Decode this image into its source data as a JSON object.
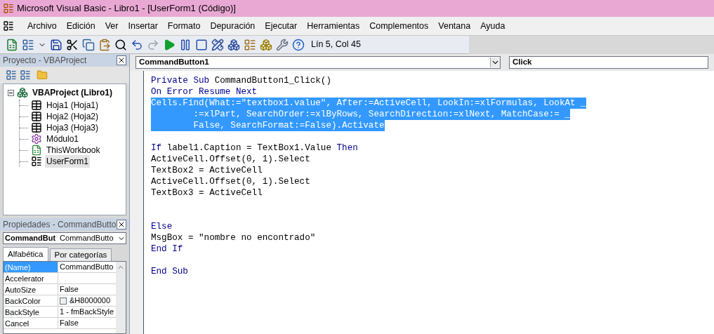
{
  "window": {
    "title": "Microsoft Visual Basic - Libro1 - [UserForm1 (Código)]"
  },
  "menu": [
    "Archivo",
    "Edición",
    "Ver",
    "Insertar",
    "Formato",
    "Depuración",
    "Ejecutar",
    "Herramientas",
    "Complementos",
    "Ventana",
    "Ayuda"
  ],
  "toolbar": {
    "position": "Lín 5, Col 45"
  },
  "project": {
    "title": "Proyecto - VBAProject",
    "tree": [
      {
        "label": "VBAProject (Libro1)",
        "kind": "project",
        "expanded": true,
        "selected": false,
        "children": [
          {
            "label": "Hoja1 (Hoja1)",
            "kind": "sheet",
            "selected": false
          },
          {
            "label": "Hoja2 (Hoja2)",
            "kind": "sheet",
            "selected": false
          },
          {
            "label": "Hoja3 (Hoja3)",
            "kind": "sheet",
            "selected": false
          },
          {
            "label": "Módulo1",
            "kind": "module",
            "selected": false
          },
          {
            "label": "ThisWorkbook",
            "kind": "workbook",
            "selected": false
          },
          {
            "label": "UserForm1",
            "kind": "form",
            "selected": true
          }
        ]
      }
    ]
  },
  "properties": {
    "title": "Propiedades - CommandButto",
    "object_name": "CommandBut",
    "object_type": "CommandButto",
    "tabs": [
      {
        "label": "Alfabética",
        "selected": true
      },
      {
        "label": "Por categorías",
        "selected": false
      }
    ],
    "rows": [
      {
        "name": "(Name)",
        "value": "CommandButto",
        "kind": "text",
        "selected": true
      },
      {
        "name": "Accelerator",
        "kind": "text",
        "selected": false
      },
      {
        "name": "AutoSize",
        "value": "False",
        "kind": "text",
        "selected": false
      },
      {
        "name": "BackColor",
        "value": "&H8000000",
        "kind": "color",
        "selected": false
      },
      {
        "name": "BackStyle",
        "value": "1 - fmBackStyle",
        "kind": "text",
        "selected": false
      },
      {
        "name": "Cancel",
        "value": "False",
        "kind": "text",
        "selected": false
      }
    ]
  },
  "code": {
    "object": "CommandButton1",
    "procedure": "Click",
    "lines": [
      {
        "kind": "code",
        "selected": false,
        "tokens": [
          {
            "text": "Private Sub",
            "kind": "keyword"
          },
          {
            "text": " CommandButton1_Click()",
            "kind": "plain"
          }
        ]
      },
      {
        "kind": "code",
        "selected": false,
        "tokens": [
          {
            "text": "On Error Resume Next",
            "kind": "keyword"
          }
        ]
      },
      {
        "kind": "code",
        "selected": true,
        "tokens": [
          {
            "text": "Cells.Find(What:=\"textbox1.value\", After:=ActiveCell, LookIn:=xlFormulas, LookAt _"
          }
        ]
      },
      {
        "kind": "code",
        "selected": true,
        "tokens": [
          {
            "text": "        :=xlPart, SearchOrder:=xlByRows, SearchDirection:=xlNext, MatchCase:= _"
          }
        ]
      },
      {
        "kind": "code",
        "selected": true,
        "tokens": [
          {
            "text": "        False, SearchFormat:=False).Activate"
          }
        ]
      },
      {
        "kind": "blank"
      },
      {
        "kind": "code",
        "selected": false,
        "tokens": [
          {
            "text": "If",
            "kind": "keyword"
          },
          {
            "text": " label1.Caption = TextBox1.Value ",
            "kind": "plain"
          },
          {
            "text": "Then",
            "kind": "keyword"
          }
        ]
      },
      {
        "kind": "code",
        "selected": false,
        "tokens": [
          {
            "text": "ActiveCell.Offset(0, 1).Select",
            "kind": "plain"
          }
        ]
      },
      {
        "kind": "code",
        "selected": false,
        "tokens": [
          {
            "text": "TextBox2 = ActiveCell",
            "kind": "plain"
          }
        ]
      },
      {
        "kind": "code",
        "selected": false,
        "tokens": [
          {
            "text": "ActiveCell.Offset(0, 1).Select",
            "kind": "plain"
          }
        ]
      },
      {
        "kind": "code",
        "selected": false,
        "tokens": [
          {
            "text": "TextBox3 = ActiveCell",
            "kind": "plain"
          }
        ]
      },
      {
        "kind": "blank"
      },
      {
        "kind": "blank"
      },
      {
        "kind": "code",
        "selected": false,
        "tokens": [
          {
            "text": "Else",
            "kind": "keyword"
          }
        ]
      },
      {
        "kind": "code",
        "selected": false,
        "tokens": [
          {
            "text": "MsgBox = \"nombre no encontrado\"",
            "kind": "plain"
          }
        ]
      },
      {
        "kind": "code",
        "selected": false,
        "tokens": [
          {
            "text": "End If",
            "kind": "keyword"
          }
        ]
      },
      {
        "kind": "blank"
      },
      {
        "kind": "code",
        "selected": false,
        "tokens": [
          {
            "text": "End Sub",
            "kind": "keyword"
          }
        ]
      }
    ]
  }
}
